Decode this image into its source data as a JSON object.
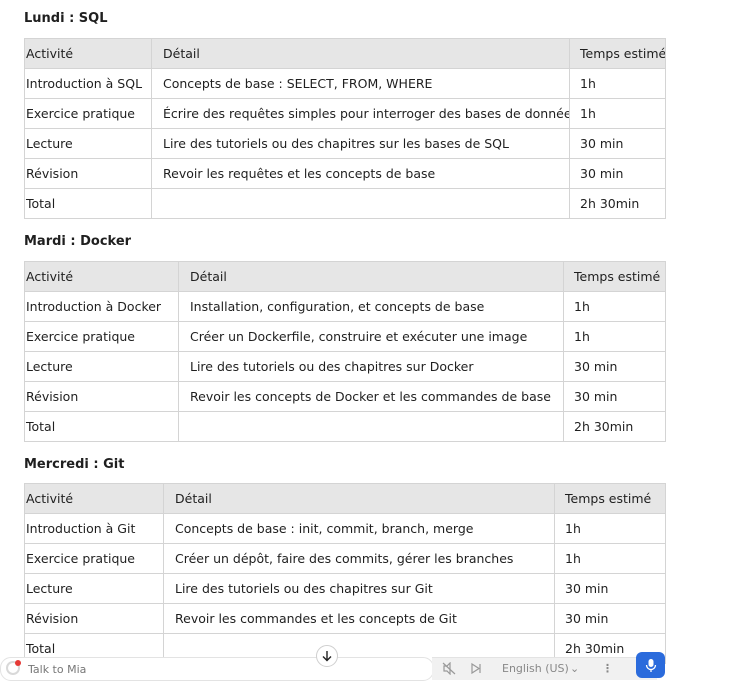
{
  "columns": [
    "Activité",
    "Détail",
    "Temps estimé"
  ],
  "sections": [
    {
      "title": "Lundi : SQL",
      "rows": [
        [
          "Introduction à SQL",
          "Concepts de base : SELECT, FROM, WHERE",
          "1h"
        ],
        [
          "Exercice pratique",
          "Écrire des requêtes simples pour interroger des bases de données",
          "1h"
        ],
        [
          "Lecture",
          "Lire des tutoriels ou des chapitres sur les bases de SQL",
          "30 min"
        ],
        [
          "Révision",
          "Revoir les requêtes et les concepts de base",
          "30 min"
        ],
        [
          "Total",
          "",
          "2h 30min"
        ]
      ]
    },
    {
      "title": "Mardi : Docker",
      "rows": [
        [
          "Introduction à Docker",
          "Installation, configuration, et concepts de base",
          "1h"
        ],
        [
          "Exercice pratique",
          "Créer un Dockerfile, construire et exécuter une image",
          "1h"
        ],
        [
          "Lecture",
          "Lire des tutoriels ou des chapitres sur Docker",
          "30 min"
        ],
        [
          "Révision",
          "Revoir les concepts de Docker et les commandes de base",
          "30 min"
        ],
        [
          "Total",
          "",
          "2h 30min"
        ]
      ]
    },
    {
      "title": "Mercredi : Git",
      "rows": [
        [
          "Introduction à Git",
          "Concepts de base : init, commit, branch, merge",
          "1h"
        ],
        [
          "Exercice pratique",
          "Créer un dépôt, faire des commits, gérer les branches",
          "1h"
        ],
        [
          "Lecture",
          "Lire des tutoriels ou des chapitres sur Git",
          "30 min"
        ],
        [
          "Révision",
          "Revoir les commandes et les concepts de Git",
          "30 min"
        ],
        [
          "Total",
          "",
          "2h 30min"
        ]
      ]
    }
  ],
  "bottom_bar": {
    "chat_label": "Talk to Mia",
    "language": "English (US)",
    "scroll_icon": "arrow-down-icon",
    "mic_icon": "microphone-icon",
    "accent_color": "#2b6bdc"
  }
}
